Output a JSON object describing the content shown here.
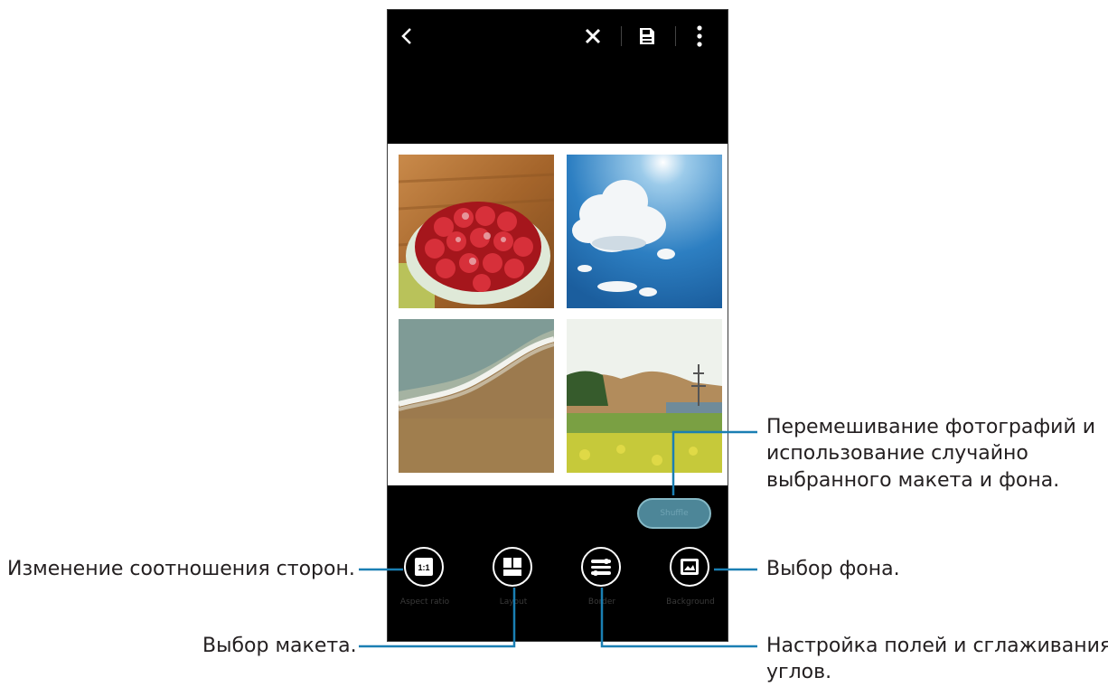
{
  "screen": {
    "toolbar": {
      "back_icon": "chevron-left-icon",
      "close_icon": "close-icon",
      "save_icon": "save-icon",
      "more_icon": "more-vertical-icon"
    },
    "photos": [
      {
        "name": "strawberry-cake-photo"
      },
      {
        "name": "sky-clouds-photo"
      },
      {
        "name": "beach-wave-photo"
      },
      {
        "name": "green-field-photo"
      }
    ],
    "shuffle_label": "Shuffle",
    "tools": [
      {
        "icon": "aspect-ratio-icon",
        "icon_text": "1:1",
        "label": "Aspect ratio"
      },
      {
        "icon": "layout-icon",
        "label": "Layout"
      },
      {
        "icon": "border-icon",
        "label": "Border"
      },
      {
        "icon": "background-icon",
        "label": "Background"
      }
    ]
  },
  "annotations": {
    "shuffle_line1": "Перемешивание фотографий и",
    "shuffle_line2": "использование случайно",
    "shuffle_line3": "выбранного макета и фона.",
    "aspect_ratio": "Изменение соотношения сторон.",
    "background": "Выбор фона.",
    "layout": "Выбор макета.",
    "border_line1": "Настройка полей и сглаживания",
    "border_line2": "углов."
  },
  "colors": {
    "callout_line": "#1a7fb3",
    "shuffle_button": "#4d8698",
    "screen_bg": "#000000"
  }
}
